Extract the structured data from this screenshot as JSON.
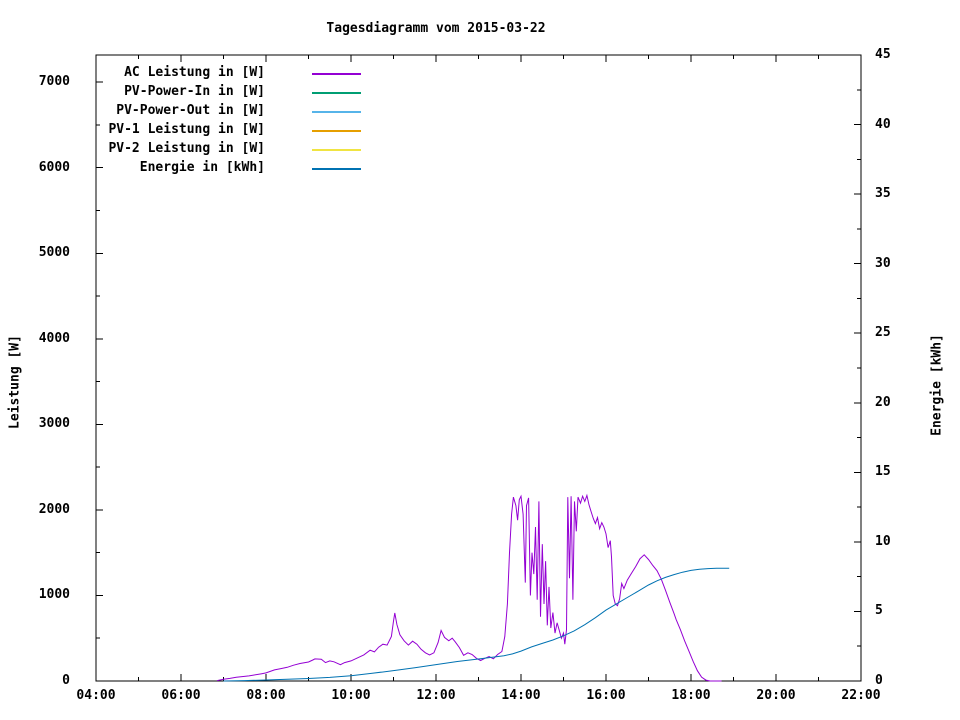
{
  "title": "Tagesdiagramm vom 2015-03-22",
  "axes": {
    "y_left": {
      "title": "Leistung [W]",
      "tick_labels": [
        "0",
        "1000",
        "2000",
        "3000",
        "4000",
        "5000",
        "6000",
        "7000"
      ],
      "tick_values": [
        0,
        1000,
        2000,
        3000,
        4000,
        5000,
        6000,
        7000
      ],
      "minor_step": 500
    },
    "y_right": {
      "title": "Energie [kWh]",
      "tick_labels": [
        "0",
        "5",
        "10",
        "15",
        "20",
        "25",
        "30",
        "35",
        "40",
        "45"
      ],
      "tick_values": [
        0,
        5,
        10,
        15,
        20,
        25,
        30,
        35,
        40,
        45
      ],
      "minor_step": 2.5
    },
    "x": {
      "tick_labels": [
        "04:00",
        "06:00",
        "08:00",
        "10:00",
        "12:00",
        "14:00",
        "16:00",
        "18:00",
        "20:00",
        "22:00"
      ],
      "tick_values": [
        4,
        6,
        8,
        10,
        12,
        14,
        16,
        18,
        20,
        22
      ],
      "minor_step": 1
    }
  },
  "chart_data": {
    "type": "line",
    "title": "Tagesdiagramm vom 2015-03-22",
    "xlabel": "",
    "ylabel_left": "Leistung [W]",
    "ylabel_right": "Energie [kWh]",
    "x_unit": "hour_of_day",
    "xlim": [
      4,
      22
    ],
    "ylim_left": [
      0,
      7318
    ],
    "ylim_right": [
      0,
      45
    ],
    "grid": false,
    "legend_position": "top-left-inside",
    "series": [
      {
        "name": "AC Leistung in [W]",
        "color": "#9400d3",
        "axis": "left",
        "points": [
          [
            6.85,
            5
          ],
          [
            7.0,
            20
          ],
          [
            7.15,
            30
          ],
          [
            7.3,
            45
          ],
          [
            7.6,
            60
          ],
          [
            7.9,
            85
          ],
          [
            8.0,
            95
          ],
          [
            8.2,
            130
          ],
          [
            8.35,
            145
          ],
          [
            8.5,
            160
          ],
          [
            8.65,
            185
          ],
          [
            8.8,
            205
          ],
          [
            9.0,
            222
          ],
          [
            9.1,
            245
          ],
          [
            9.15,
            258
          ],
          [
            9.3,
            255
          ],
          [
            9.4,
            215
          ],
          [
            9.5,
            235
          ],
          [
            9.6,
            225
          ],
          [
            9.75,
            190
          ],
          [
            9.85,
            215
          ],
          [
            10.0,
            235
          ],
          [
            10.15,
            270
          ],
          [
            10.3,
            305
          ],
          [
            10.45,
            360
          ],
          [
            10.55,
            340
          ],
          [
            10.65,
            395
          ],
          [
            10.75,
            430
          ],
          [
            10.85,
            420
          ],
          [
            10.95,
            520
          ],
          [
            11.0,
            700
          ],
          [
            11.03,
            795
          ],
          [
            11.08,
            660
          ],
          [
            11.15,
            540
          ],
          [
            11.25,
            470
          ],
          [
            11.35,
            420
          ],
          [
            11.45,
            465
          ],
          [
            11.55,
            430
          ],
          [
            11.65,
            370
          ],
          [
            11.75,
            330
          ],
          [
            11.85,
            305
          ],
          [
            11.95,
            330
          ],
          [
            12.05,
            450
          ],
          [
            12.12,
            590
          ],
          [
            12.2,
            510
          ],
          [
            12.3,
            470
          ],
          [
            12.38,
            500
          ],
          [
            12.45,
            460
          ],
          [
            12.55,
            390
          ],
          [
            12.65,
            300
          ],
          [
            12.75,
            330
          ],
          [
            12.85,
            310
          ],
          [
            12.95,
            265
          ],
          [
            13.05,
            240
          ],
          [
            13.15,
            265
          ],
          [
            13.25,
            285
          ],
          [
            13.35,
            260
          ],
          [
            13.45,
            310
          ],
          [
            13.55,
            345
          ],
          [
            13.62,
            520
          ],
          [
            13.68,
            900
          ],
          [
            13.73,
            1500
          ],
          [
            13.78,
            1950
          ],
          [
            13.82,
            2150
          ],
          [
            13.88,
            2050
          ],
          [
            13.92,
            1880
          ],
          [
            13.96,
            2120
          ],
          [
            14.0,
            2160
          ],
          [
            14.05,
            1950
          ],
          [
            14.1,
            1150
          ],
          [
            14.13,
            2050
          ],
          [
            14.18,
            2140
          ],
          [
            14.22,
            1000
          ],
          [
            14.26,
            1500
          ],
          [
            14.3,
            1250
          ],
          [
            14.34,
            1800
          ],
          [
            14.38,
            950
          ],
          [
            14.42,
            2100
          ],
          [
            14.46,
            750
          ],
          [
            14.5,
            1600
          ],
          [
            14.54,
            900
          ],
          [
            14.58,
            1400
          ],
          [
            14.62,
            650
          ],
          [
            14.66,
            1100
          ],
          [
            14.7,
            620
          ],
          [
            14.75,
            800
          ],
          [
            14.8,
            560
          ],
          [
            14.85,
            680
          ],
          [
            14.9,
            590
          ],
          [
            14.95,
            500
          ],
          [
            15.0,
            560
          ],
          [
            15.03,
            430
          ],
          [
            15.07,
            600
          ],
          [
            15.1,
            2150
          ],
          [
            15.14,
            1200
          ],
          [
            15.18,
            2160
          ],
          [
            15.22,
            950
          ],
          [
            15.26,
            2100
          ],
          [
            15.3,
            1750
          ],
          [
            15.34,
            2150
          ],
          [
            15.4,
            2080
          ],
          [
            15.45,
            2160
          ],
          [
            15.5,
            2100
          ],
          [
            15.55,
            2170
          ],
          [
            15.6,
            2060
          ],
          [
            15.65,
            1980
          ],
          [
            15.7,
            1900
          ],
          [
            15.75,
            1840
          ],
          [
            15.8,
            1910
          ],
          [
            15.85,
            1780
          ],
          [
            15.9,
            1850
          ],
          [
            15.95,
            1800
          ],
          [
            16.0,
            1720
          ],
          [
            16.05,
            1560
          ],
          [
            16.1,
            1640
          ],
          [
            16.13,
            1450
          ],
          [
            16.17,
            1000
          ],
          [
            16.22,
            900
          ],
          [
            16.27,
            880
          ],
          [
            16.32,
            960
          ],
          [
            16.37,
            1140
          ],
          [
            16.42,
            1080
          ],
          [
            16.5,
            1180
          ],
          [
            16.6,
            1260
          ],
          [
            16.7,
            1340
          ],
          [
            16.8,
            1430
          ],
          [
            16.9,
            1475
          ],
          [
            17.0,
            1420
          ],
          [
            17.1,
            1350
          ],
          [
            17.2,
            1290
          ],
          [
            17.3,
            1190
          ],
          [
            17.4,
            1060
          ],
          [
            17.5,
            920
          ],
          [
            17.6,
            790
          ],
          [
            17.65,
            720
          ],
          [
            17.75,
            600
          ],
          [
            17.85,
            470
          ],
          [
            17.95,
            350
          ],
          [
            18.05,
            230
          ],
          [
            18.15,
            120
          ],
          [
            18.25,
            45
          ],
          [
            18.35,
            10
          ],
          [
            18.45,
            0
          ],
          [
            18.72,
            0
          ]
        ]
      },
      {
        "name": "PV-Power-In in [W]",
        "color": "#009e73",
        "axis": "left",
        "points": []
      },
      {
        "name": "PV-Power-Out in [W]",
        "color": "#56b4e9",
        "axis": "left",
        "points": []
      },
      {
        "name": "PV-1 Leistung in [W]",
        "color": "#e69f00",
        "axis": "left",
        "points": []
      },
      {
        "name": "PV-2 Leistung in [W]",
        "color": "#f0e442",
        "axis": "left",
        "points": []
      },
      {
        "name": "Energie in [kWh]",
        "color": "#0072b2",
        "axis": "right",
        "points": [
          [
            7.0,
            0.0
          ],
          [
            7.5,
            0.03
          ],
          [
            8.0,
            0.07
          ],
          [
            8.5,
            0.12
          ],
          [
            9.0,
            0.18
          ],
          [
            9.5,
            0.26
          ],
          [
            10.0,
            0.38
          ],
          [
            10.5,
            0.55
          ],
          [
            11.0,
            0.75
          ],
          [
            11.5,
            0.95
          ],
          [
            12.0,
            1.18
          ],
          [
            12.5,
            1.4
          ],
          [
            13.0,
            1.58
          ],
          [
            13.3,
            1.7
          ],
          [
            13.6,
            1.82
          ],
          [
            13.8,
            1.95
          ],
          [
            14.0,
            2.15
          ],
          [
            14.25,
            2.45
          ],
          [
            14.5,
            2.7
          ],
          [
            14.75,
            2.95
          ],
          [
            15.0,
            3.25
          ],
          [
            15.25,
            3.6
          ],
          [
            15.5,
            4.05
          ],
          [
            15.75,
            4.55
          ],
          [
            16.0,
            5.1
          ],
          [
            16.25,
            5.55
          ],
          [
            16.5,
            6.0
          ],
          [
            16.75,
            6.45
          ],
          [
            17.0,
            6.9
          ],
          [
            17.2,
            7.2
          ],
          [
            17.4,
            7.45
          ],
          [
            17.6,
            7.65
          ],
          [
            17.8,
            7.82
          ],
          [
            18.0,
            7.95
          ],
          [
            18.2,
            8.03
          ],
          [
            18.4,
            8.08
          ],
          [
            18.6,
            8.1
          ],
          [
            18.9,
            8.1
          ]
        ]
      }
    ]
  }
}
